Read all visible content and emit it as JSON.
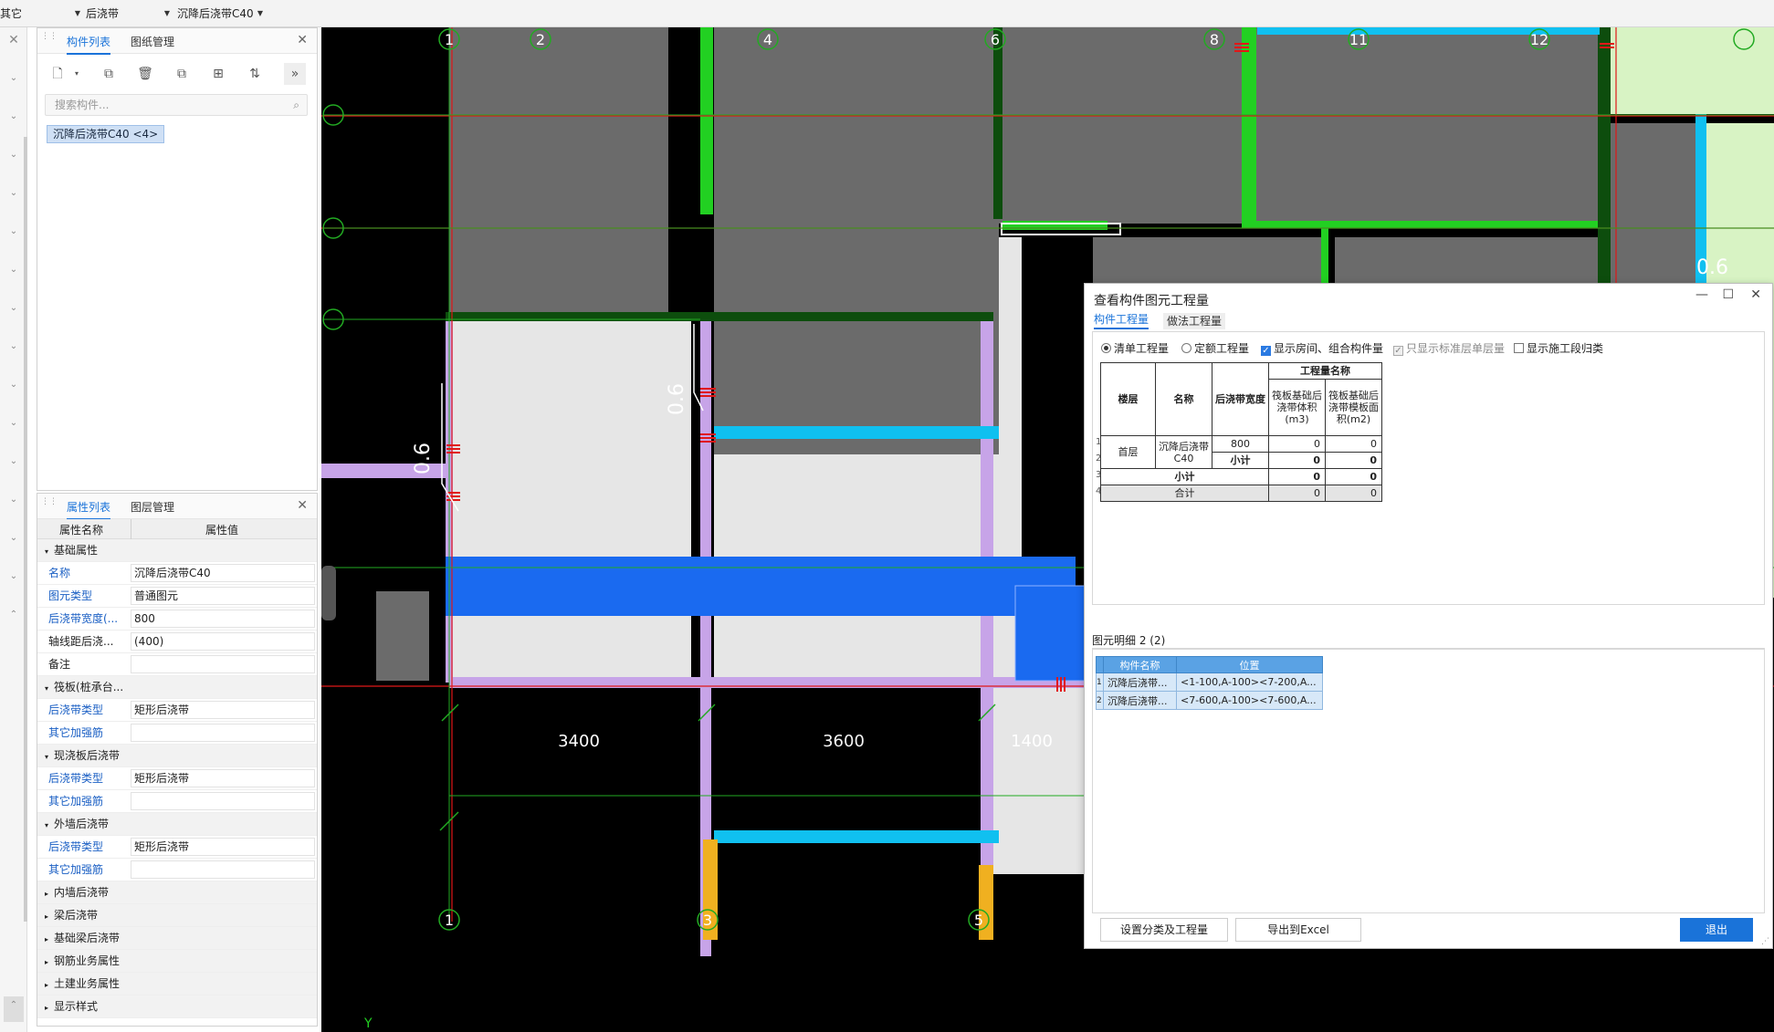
{
  "topbar": {
    "dropdowns": [
      {
        "label": "其它"
      },
      {
        "label": "后浇带"
      },
      {
        "label": "沉降后浇带C40"
      }
    ]
  },
  "component_panel": {
    "tabs": [
      {
        "label": "构件列表"
      },
      {
        "label": "图纸管理"
      }
    ],
    "search_placeholder": "搜索构件...",
    "items": [
      {
        "label": "沉降后浇带C40 <4>"
      }
    ]
  },
  "property_panel": {
    "tabs": [
      {
        "label": "属性列表"
      },
      {
        "label": "图层管理"
      }
    ],
    "headers": {
      "name": "属性名称",
      "value": "属性值"
    },
    "rows": [
      {
        "type": "group",
        "label": "基础属性"
      },
      {
        "type": "prop",
        "label": "名称",
        "value": "沉降后浇带C40",
        "blue": true
      },
      {
        "type": "prop",
        "label": "图元类型",
        "value": "普通图元",
        "blue": true
      },
      {
        "type": "prop",
        "label": "后浇带宽度(...",
        "value": "800",
        "blue": true
      },
      {
        "type": "prop",
        "label": "轴线距后浇...",
        "value": "(400)",
        "blue": false
      },
      {
        "type": "prop",
        "label": "备注",
        "value": "",
        "blue": false
      },
      {
        "type": "group",
        "label": "筏板(桩承台..."
      },
      {
        "type": "prop",
        "label": "后浇带类型",
        "value": "矩形后浇带",
        "blue": true
      },
      {
        "type": "prop",
        "label": "其它加强筋",
        "value": "",
        "blue": true
      },
      {
        "type": "group",
        "label": "现浇板后浇带"
      },
      {
        "type": "prop",
        "label": "后浇带类型",
        "value": "矩形后浇带",
        "blue": true
      },
      {
        "type": "prop",
        "label": "其它加强筋",
        "value": "",
        "blue": true
      },
      {
        "type": "group",
        "label": "外墙后浇带"
      },
      {
        "type": "prop",
        "label": "后浇带类型",
        "value": "矩形后浇带",
        "blue": true
      },
      {
        "type": "prop",
        "label": "其它加强筋",
        "value": "",
        "blue": true
      },
      {
        "type": "group",
        "label": "内墙后浇带",
        "collapsed": true
      },
      {
        "type": "group",
        "label": "梁后浇带",
        "collapsed": true
      },
      {
        "type": "group",
        "label": "基础梁后浇带",
        "collapsed": true
      },
      {
        "type": "group",
        "label": "钢筋业务属性",
        "collapsed": true
      },
      {
        "type": "group",
        "label": "土建业务属性",
        "collapsed": true
      },
      {
        "type": "group",
        "label": "显示样式",
        "collapsed": true
      }
    ]
  },
  "cad": {
    "axis_top": [
      "1",
      "2",
      "4",
      "6",
      "8",
      "11",
      "12"
    ],
    "axis_bottom": [
      "1",
      "3",
      "5"
    ],
    "dimensions": [
      "3400",
      "3600",
      "1400"
    ],
    "slope_labels": [
      "0.6",
      "0.6",
      "0.6"
    ],
    "ucs_label": "Y",
    "colors": {
      "background": "#000000",
      "slab": "#6b6b6b",
      "light_slab": "#e6e6e6",
      "green_beam": "#22d022",
      "dark_green_beam": "#0d4d0d",
      "cyan": "#10c0f0",
      "violet_wall": "#c7a4e8",
      "blue_band": "#1a6af0",
      "yellow": "#f0b020",
      "pale_green": "#d8f3c4",
      "axis_line": "#22aa22",
      "red_line": "#e01818"
    }
  },
  "dialog": {
    "title": "查看构件图元工程量",
    "tabs": [
      {
        "label": "构件工程量"
      },
      {
        "label": "做法工程量"
      }
    ],
    "options": [
      {
        "kind": "radio",
        "label": "清单工程量",
        "on": true
      },
      {
        "kind": "radio",
        "label": "定额工程量",
        "on": false
      },
      {
        "kind": "check",
        "label": "显示房间、组合构件量",
        "on": true
      },
      {
        "kind": "check",
        "label": "只显示标准层单层量",
        "on": true,
        "disabled": true
      },
      {
        "kind": "check",
        "label": "显示施工段归类",
        "on": false
      }
    ],
    "table": {
      "col_floor": "楼层",
      "col_name": "名称",
      "col_width": "后浇带宽度",
      "group_header": "工程量名称",
      "col_volume": "筏板基础后浇带体积(m3)",
      "col_formwork": "筏板基础后浇带模板面积(m2)",
      "row_numbers": [
        "1",
        "2",
        "3",
        "4"
      ],
      "floor": "首层",
      "name": "沉降后浇带C40",
      "width": "800",
      "row1_volume": "0",
      "row1_formwork": "0",
      "subtotal_label": "小计",
      "row2_volume": "0",
      "row2_formwork": "0",
      "row3_volume": "0",
      "row3_formwork": "0",
      "total_label": "合计",
      "row4_volume": "0",
      "row4_formwork": "0"
    },
    "detail_title": "图元明细  2 (2)",
    "detail": {
      "col_name": "构件名称",
      "col_position": "位置",
      "rows": [
        {
          "num": "1",
          "name": "沉降后浇带...",
          "position": "<1-100,A-100><7-200,A..."
        },
        {
          "num": "2",
          "name": "沉降后浇带...",
          "position": "<7-600,A-100><7-600,A..."
        }
      ]
    },
    "buttons": {
      "classify": "设置分类及工程量",
      "export": "导出到Excel",
      "exit": "退出"
    }
  }
}
